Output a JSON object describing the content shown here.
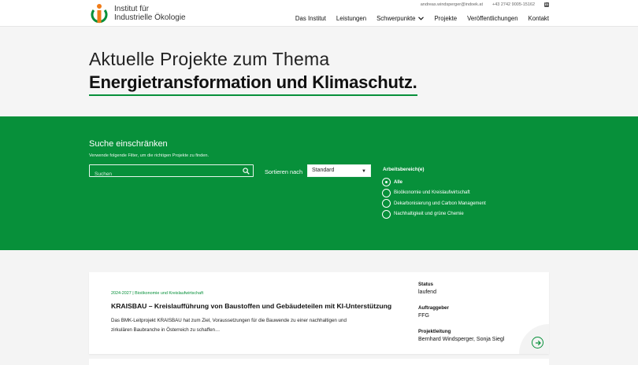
{
  "header": {
    "logo": {
      "line1": "Institut für",
      "line2": "Industrielle Ökologie"
    },
    "email": "andreas.windsperger@indoek.at",
    "phone": "+43 2742 9005-15162",
    "linkedin_label": "in",
    "nav": [
      {
        "label": "Das Institut"
      },
      {
        "label": "Leistungen"
      },
      {
        "label": "Schwerpunkte"
      },
      {
        "label": "Projekte"
      },
      {
        "label": "Veröffentlichungen"
      },
      {
        "label": "Kontakt"
      }
    ]
  },
  "hero": {
    "line1": "Aktuelle Projekte zum Thema",
    "line2": "Energietransformation und Klimaschutz."
  },
  "filter": {
    "title": "Suche einschränken",
    "subtitle": "Verwende folgende Filter, um die richtigen Projekte zu finden.",
    "search_placeholder": "Suchen",
    "sort_label": "Sortieren nach",
    "sort_value": "Standard",
    "area_title": "Arbeitsbereich(e)",
    "areas": [
      {
        "label": "Alle",
        "checked": true
      },
      {
        "label": "Bioökonomie und Kreislaufwirtschaft",
        "checked": false
      },
      {
        "label": "Dekarbonisierung und Carbon Management",
        "checked": false
      },
      {
        "label": "Nachhaltigkeit und grüne Chemie",
        "checked": false
      }
    ]
  },
  "project": {
    "meta": "2024-2027 | Bioökonomie und Kreislaufwirtschaft",
    "title": "KRAISBAU – Kreislaufführung von Baustoffen und Gebäudeteilen mit KI-Unterstützung",
    "description_line1": "Das BMK-Leitprojekt KRAISBAU hat zum Ziel, Voraussetzungen für die Bauwende zu einer nachhaltigen und",
    "description_line2": "zirkulären Baubranche in Österreich zu schaffen…",
    "status_label": "Status",
    "status_value": "laufend",
    "client_label": "Auftraggeber",
    "client_value": "FFG",
    "lead_label": "Projektleitung",
    "lead_value": "Bernhard Windsperger, Sonja Siegl"
  },
  "colors": {
    "brand_green": "#07903a",
    "logo_orange": "#f07c18"
  }
}
